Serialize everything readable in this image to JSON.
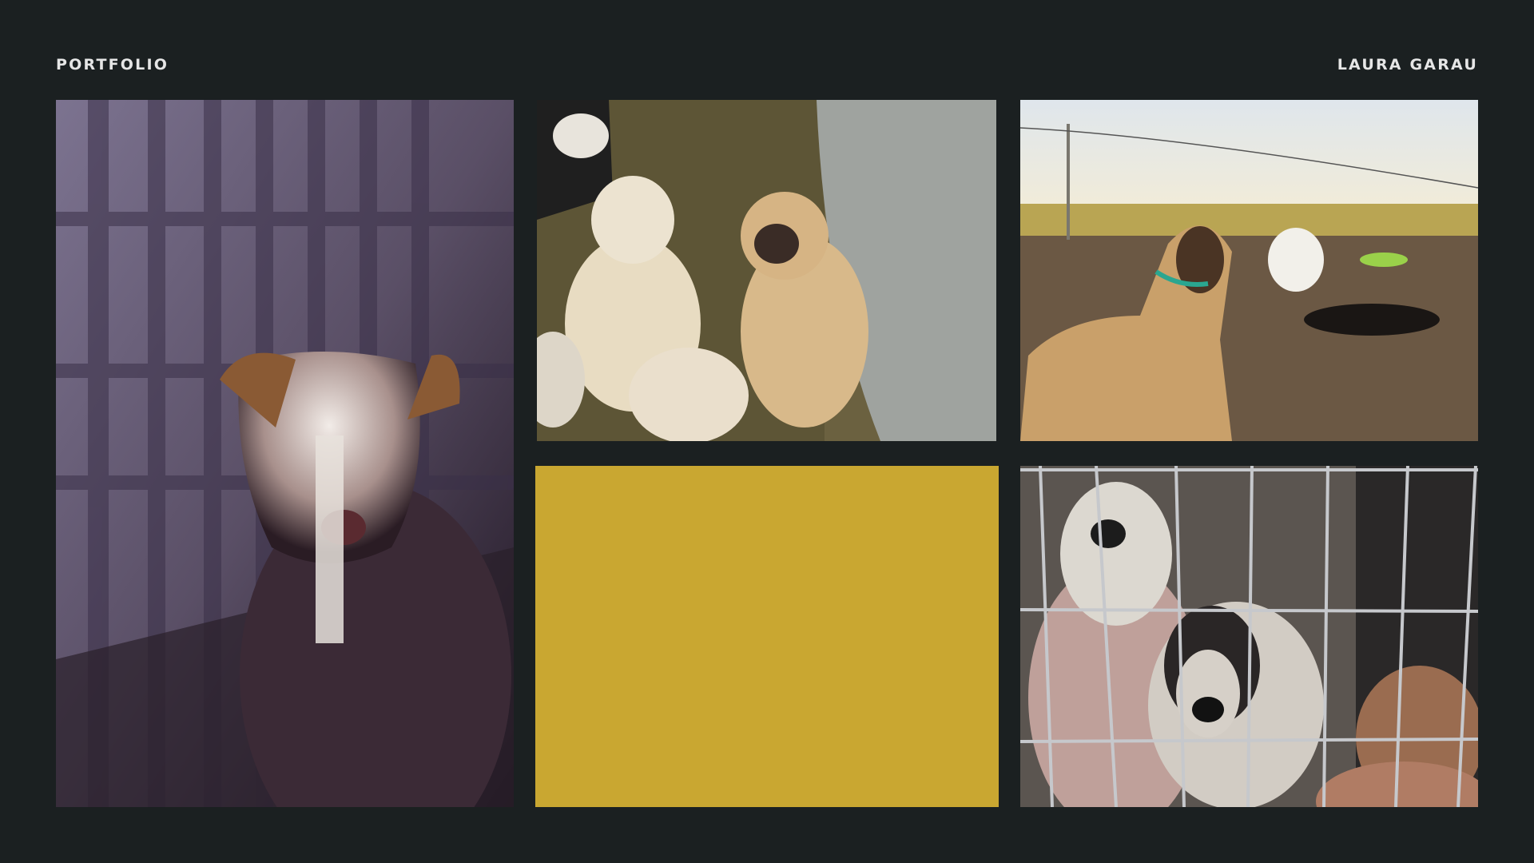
{
  "header": {
    "left_label": "PORTFOLIO",
    "right_label": "LAURA GARAU"
  },
  "tiles": [
    {
      "kind": "photo",
      "subject": "dog behind shadowed bars",
      "icon": "photo-icon"
    },
    {
      "kind": "photo",
      "subject": "puppies looking up",
      "icon": "photo-icon"
    },
    {
      "kind": "photo",
      "subject": "tan dog in field",
      "icon": "photo-icon"
    },
    {
      "kind": "color-block",
      "color": "#c9a731"
    },
    {
      "kind": "photo",
      "subject": "two dogs behind wire fence",
      "icon": "photo-icon"
    }
  ],
  "colors": {
    "background": "#1b2021",
    "text": "#e6e6e6",
    "accent": "#c9a731"
  }
}
